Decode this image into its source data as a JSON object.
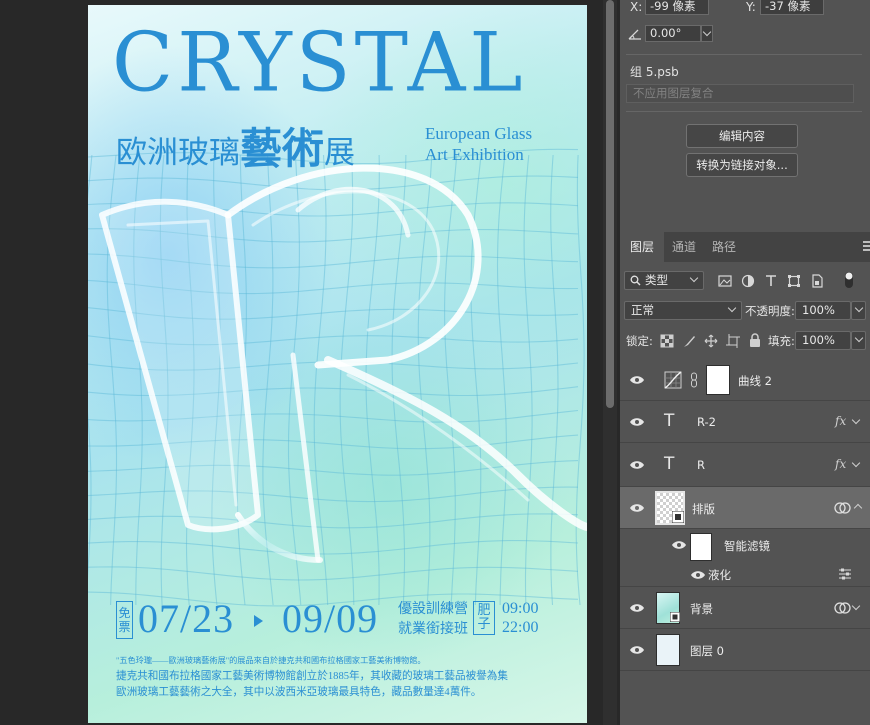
{
  "poster": {
    "title": "CRYSTAL",
    "cn_part1": "欧洲玻璃",
    "cn_part2": "藝術",
    "cn_part3": "展",
    "en_line1": "European Glass",
    "en_line2": "Art Exhibition",
    "seal_free_1": "免",
    "seal_free_2": "票",
    "date_start": "07/23",
    "date_end": "09/09",
    "course_line1": "優設訓練營",
    "course_line2": "就業銜接班",
    "seal_fei_1": "肥",
    "seal_fei_2": "子",
    "time_1": "09:00",
    "time_2": "22:00",
    "desc_line1": "\"五色玲瓏——歐洲玻璃藝術展\"的展品來自於捷克共和國布拉格國家工藝美術博物館。",
    "desc_line2": "捷克共和國布拉格國家工藝美術博物館創立於1885年，其收藏的玻璃工藝品被譽為集",
    "desc_line3": "歐洲玻璃工藝藝術之大全，其中以波西米亞玻璃最具特色，藏品數量達4萬件。"
  },
  "properties": {
    "x_label": "X:",
    "x_value": "-99 像素",
    "y_label": "Y:",
    "y_value": "-37 像素",
    "angle_value": "0.00°",
    "file_name": "组 5.psb",
    "comp_select": "不应用图层复合",
    "edit_contents_button": "编辑内容",
    "convert_link_button": "转换为链接对象..."
  },
  "layers_panel": {
    "tabs": [
      "图层",
      "通道",
      "路径"
    ],
    "filter_kind": "类型",
    "blend_mode": "正常",
    "opacity_label": "不透明度:",
    "opacity_value": "100%",
    "lock_label": "锁定:",
    "fill_label": "填充:",
    "fill_value": "100%",
    "fx_label": "fx",
    "text_layer_glyph": "T",
    "layers": [
      {
        "name": "曲线 2"
      },
      {
        "name": "R-2"
      },
      {
        "name": "R"
      },
      {
        "name": "排版"
      },
      {
        "name": "智能滤镜"
      },
      {
        "name": "液化"
      },
      {
        "name": "背景"
      },
      {
        "name": "图层 0"
      }
    ]
  },
  "colors": {
    "poster_accent": "#2a8fd3",
    "panel_bg": "#535353",
    "app_bg": "#282828"
  }
}
